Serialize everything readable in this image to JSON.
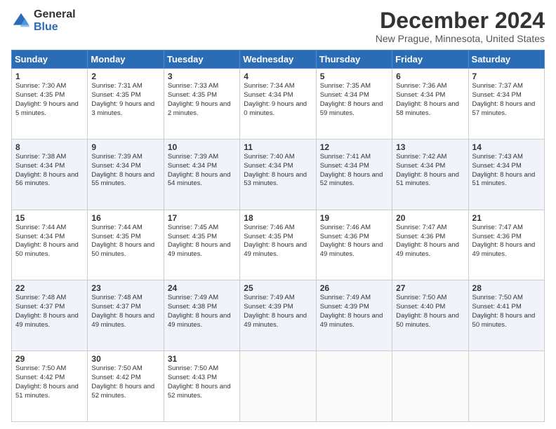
{
  "logo": {
    "general": "General",
    "blue": "Blue"
  },
  "header": {
    "title": "December 2024",
    "subtitle": "New Prague, Minnesota, United States"
  },
  "days_of_week": [
    "Sunday",
    "Monday",
    "Tuesday",
    "Wednesday",
    "Thursday",
    "Friday",
    "Saturday"
  ],
  "weeks": [
    [
      {
        "day": 1,
        "sunrise": "7:30 AM",
        "sunset": "4:35 PM",
        "daylight": "9 hours and 5 minutes."
      },
      {
        "day": 2,
        "sunrise": "7:31 AM",
        "sunset": "4:35 PM",
        "daylight": "9 hours and 3 minutes."
      },
      {
        "day": 3,
        "sunrise": "7:33 AM",
        "sunset": "4:35 PM",
        "daylight": "9 hours and 2 minutes."
      },
      {
        "day": 4,
        "sunrise": "7:34 AM",
        "sunset": "4:34 PM",
        "daylight": "9 hours and 0 minutes."
      },
      {
        "day": 5,
        "sunrise": "7:35 AM",
        "sunset": "4:34 PM",
        "daylight": "8 hours and 59 minutes."
      },
      {
        "day": 6,
        "sunrise": "7:36 AM",
        "sunset": "4:34 PM",
        "daylight": "8 hours and 58 minutes."
      },
      {
        "day": 7,
        "sunrise": "7:37 AM",
        "sunset": "4:34 PM",
        "daylight": "8 hours and 57 minutes."
      }
    ],
    [
      {
        "day": 8,
        "sunrise": "7:38 AM",
        "sunset": "4:34 PM",
        "daylight": "8 hours and 56 minutes."
      },
      {
        "day": 9,
        "sunrise": "7:39 AM",
        "sunset": "4:34 PM",
        "daylight": "8 hours and 55 minutes."
      },
      {
        "day": 10,
        "sunrise": "7:39 AM",
        "sunset": "4:34 PM",
        "daylight": "8 hours and 54 minutes."
      },
      {
        "day": 11,
        "sunrise": "7:40 AM",
        "sunset": "4:34 PM",
        "daylight": "8 hours and 53 minutes."
      },
      {
        "day": 12,
        "sunrise": "7:41 AM",
        "sunset": "4:34 PM",
        "daylight": "8 hours and 52 minutes."
      },
      {
        "day": 13,
        "sunrise": "7:42 AM",
        "sunset": "4:34 PM",
        "daylight": "8 hours and 51 minutes."
      },
      {
        "day": 14,
        "sunrise": "7:43 AM",
        "sunset": "4:34 PM",
        "daylight": "8 hours and 51 minutes."
      }
    ],
    [
      {
        "day": 15,
        "sunrise": "7:44 AM",
        "sunset": "4:34 PM",
        "daylight": "8 hours and 50 minutes."
      },
      {
        "day": 16,
        "sunrise": "7:44 AM",
        "sunset": "4:35 PM",
        "daylight": "8 hours and 50 minutes."
      },
      {
        "day": 17,
        "sunrise": "7:45 AM",
        "sunset": "4:35 PM",
        "daylight": "8 hours and 49 minutes."
      },
      {
        "day": 18,
        "sunrise": "7:46 AM",
        "sunset": "4:35 PM",
        "daylight": "8 hours and 49 minutes."
      },
      {
        "day": 19,
        "sunrise": "7:46 AM",
        "sunset": "4:36 PM",
        "daylight": "8 hours and 49 minutes."
      },
      {
        "day": 20,
        "sunrise": "7:47 AM",
        "sunset": "4:36 PM",
        "daylight": "8 hours and 49 minutes."
      },
      {
        "day": 21,
        "sunrise": "7:47 AM",
        "sunset": "4:36 PM",
        "daylight": "8 hours and 49 minutes."
      }
    ],
    [
      {
        "day": 22,
        "sunrise": "7:48 AM",
        "sunset": "4:37 PM",
        "daylight": "8 hours and 49 minutes."
      },
      {
        "day": 23,
        "sunrise": "7:48 AM",
        "sunset": "4:37 PM",
        "daylight": "8 hours and 49 minutes."
      },
      {
        "day": 24,
        "sunrise": "7:49 AM",
        "sunset": "4:38 PM",
        "daylight": "8 hours and 49 minutes."
      },
      {
        "day": 25,
        "sunrise": "7:49 AM",
        "sunset": "4:39 PM",
        "daylight": "8 hours and 49 minutes."
      },
      {
        "day": 26,
        "sunrise": "7:49 AM",
        "sunset": "4:39 PM",
        "daylight": "8 hours and 49 minutes."
      },
      {
        "day": 27,
        "sunrise": "7:50 AM",
        "sunset": "4:40 PM",
        "daylight": "8 hours and 50 minutes."
      },
      {
        "day": 28,
        "sunrise": "7:50 AM",
        "sunset": "4:41 PM",
        "daylight": "8 hours and 50 minutes."
      }
    ],
    [
      {
        "day": 29,
        "sunrise": "7:50 AM",
        "sunset": "4:42 PM",
        "daylight": "8 hours and 51 minutes."
      },
      {
        "day": 30,
        "sunrise": "7:50 AM",
        "sunset": "4:42 PM",
        "daylight": "8 hours and 52 minutes."
      },
      {
        "day": 31,
        "sunrise": "7:50 AM",
        "sunset": "4:43 PM",
        "daylight": "8 hours and 52 minutes."
      },
      null,
      null,
      null,
      null
    ]
  ],
  "labels": {
    "sunrise": "Sunrise:",
    "sunset": "Sunset:",
    "daylight": "Daylight:"
  }
}
